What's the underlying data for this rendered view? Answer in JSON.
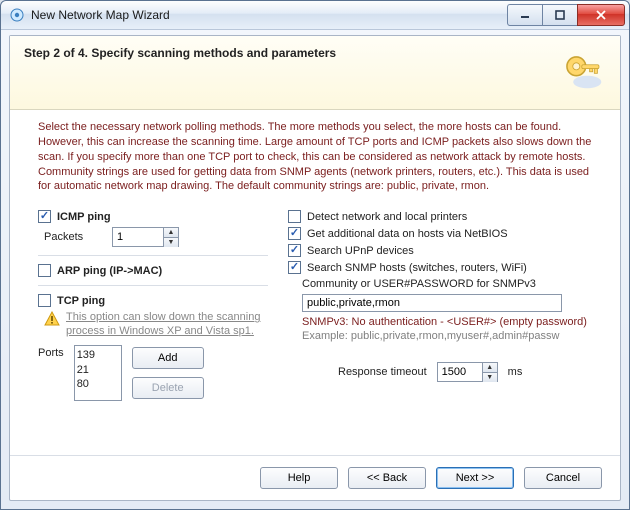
{
  "window": {
    "title": "New Network Map Wizard"
  },
  "header": {
    "step_title": "Step 2 of 4. Specify scanning methods and parameters"
  },
  "intro": "Select the necessary network polling methods. The more methods you select, the more hosts can be found. However, this can increase the scanning time. Large amount of TCP ports and ICMP packets also slows down the scan. If you specify more than one TCP port to check, this can be considered as network attack by remote hosts. Community strings are used for getting data from SNMP agents (network printers, routers, etc.). This data is used for automatic network map drawing. The default community strings are: public, private, rmon.",
  "left": {
    "icmp": {
      "label": "ICMP ping",
      "checked": true,
      "packets_label": "Packets",
      "packets_value": "1"
    },
    "arp": {
      "label": "ARP ping (IP->MAC)",
      "checked": false
    },
    "tcp": {
      "label": "TCP ping",
      "checked": false,
      "note": "This option can slow down the scanning process in Windows XP and Vista sp1."
    },
    "ports": {
      "label": "Ports",
      "list": [
        "139",
        "21",
        "80"
      ],
      "add_label": "Add",
      "delete_label": "Delete"
    }
  },
  "right": {
    "detect_printers": {
      "label": "Detect network and local printers",
      "checked": false
    },
    "netbios": {
      "label": "Get additional data on hosts via NetBIOS",
      "checked": true
    },
    "upnp": {
      "label": "Search UPnP devices",
      "checked": true
    },
    "snmp": {
      "label": "Search SNMP hosts (switches, routers, WiFi)",
      "checked": true,
      "community_label": "Community or USER#PASSWORD for SNMPv3",
      "community_value": "public,private,rmon",
      "v3note": "SNMPv3: No authentication - <USER#> (empty password)",
      "example": "Example: public,private,rmon,myuser#,admin#passw"
    },
    "timeout": {
      "label": "Response timeout",
      "value": "1500",
      "unit": "ms"
    }
  },
  "footer": {
    "help": "Help",
    "back": "<<  Back",
    "next": "Next  >>",
    "cancel": "Cancel"
  }
}
